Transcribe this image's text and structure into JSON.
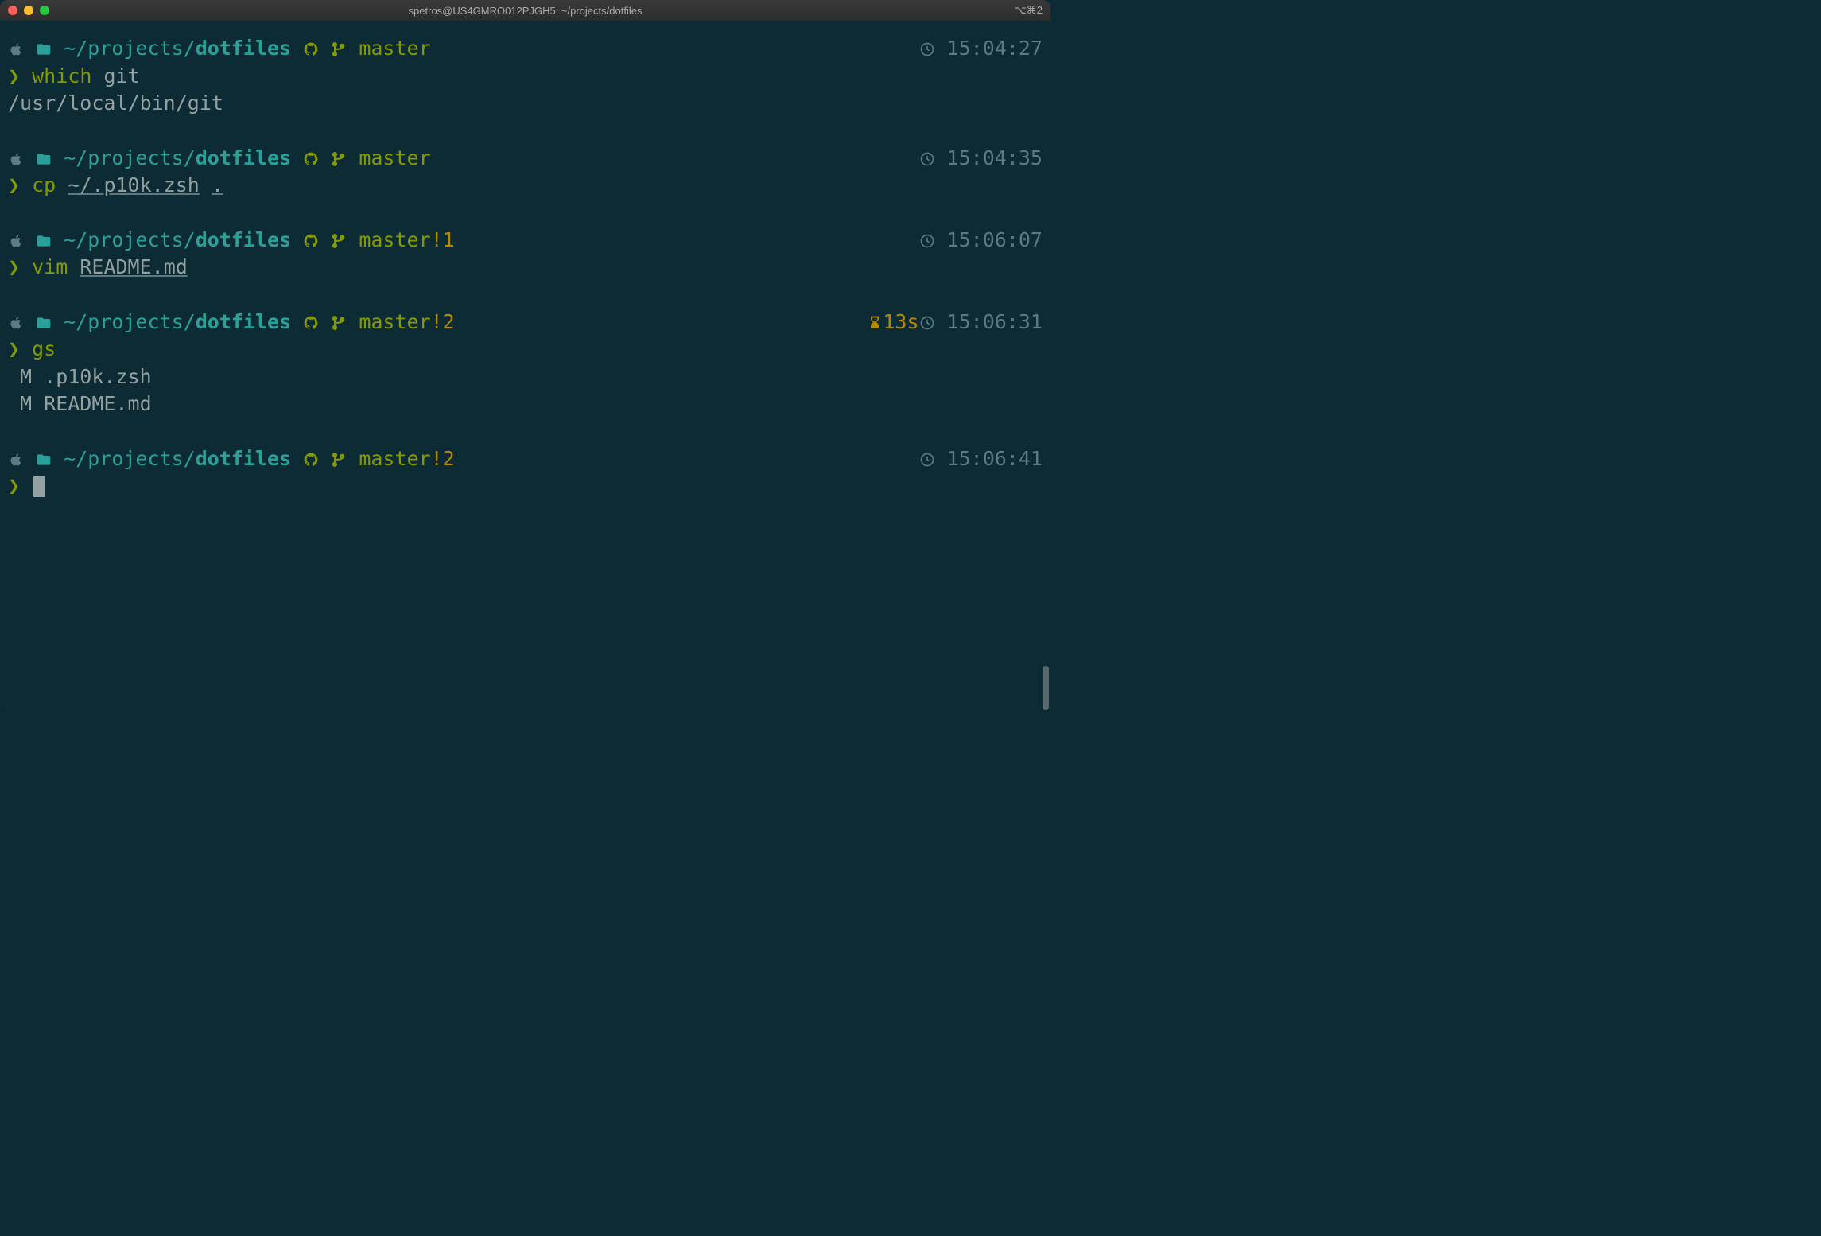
{
  "titlebar": {
    "title": "spetros@US4GMRO012PJGH5: ~/projects/dotfiles",
    "right": "⌥⌘2"
  },
  "blocks": [
    {
      "path_prefix": "~/projects/",
      "path_bold": "dotfiles",
      "branch": "master",
      "status": "",
      "duration": "",
      "time": "15:04:27",
      "command": [
        {
          "text": "which",
          "cls": "green"
        },
        {
          "text": " git",
          "cls": "light"
        }
      ],
      "output": [
        "/usr/local/bin/git"
      ]
    },
    {
      "path_prefix": "~/projects/",
      "path_bold": "dotfiles",
      "branch": "master",
      "status": "",
      "duration": "",
      "time": "15:04:35",
      "command": [
        {
          "text": "cp",
          "cls": "green"
        },
        {
          "text": " ",
          "cls": "light"
        },
        {
          "text": "~/.p10k.zsh",
          "cls": "light underline"
        },
        {
          "text": " ",
          "cls": "light"
        },
        {
          "text": ".",
          "cls": "light underline"
        }
      ],
      "output": []
    },
    {
      "path_prefix": "~/projects/",
      "path_bold": "dotfiles",
      "branch": "master",
      "status": "!1",
      "duration": "",
      "time": "15:06:07",
      "command": [
        {
          "text": "vim",
          "cls": "green"
        },
        {
          "text": " ",
          "cls": "light"
        },
        {
          "text": "README.md",
          "cls": "light underline"
        }
      ],
      "output": []
    },
    {
      "path_prefix": "~/projects/",
      "path_bold": "dotfiles",
      "branch": "master",
      "status": "!2",
      "duration": "13s",
      "time": "15:06:31",
      "command": [
        {
          "text": "gs",
          "cls": "green"
        }
      ],
      "output": [
        " M .p10k.zsh",
        " M README.md"
      ]
    },
    {
      "path_prefix": "~/projects/",
      "path_bold": "dotfiles",
      "branch": "master",
      "status": "!2",
      "duration": "",
      "time": "15:06:41",
      "command": [],
      "output": [],
      "cursor": true
    }
  ]
}
